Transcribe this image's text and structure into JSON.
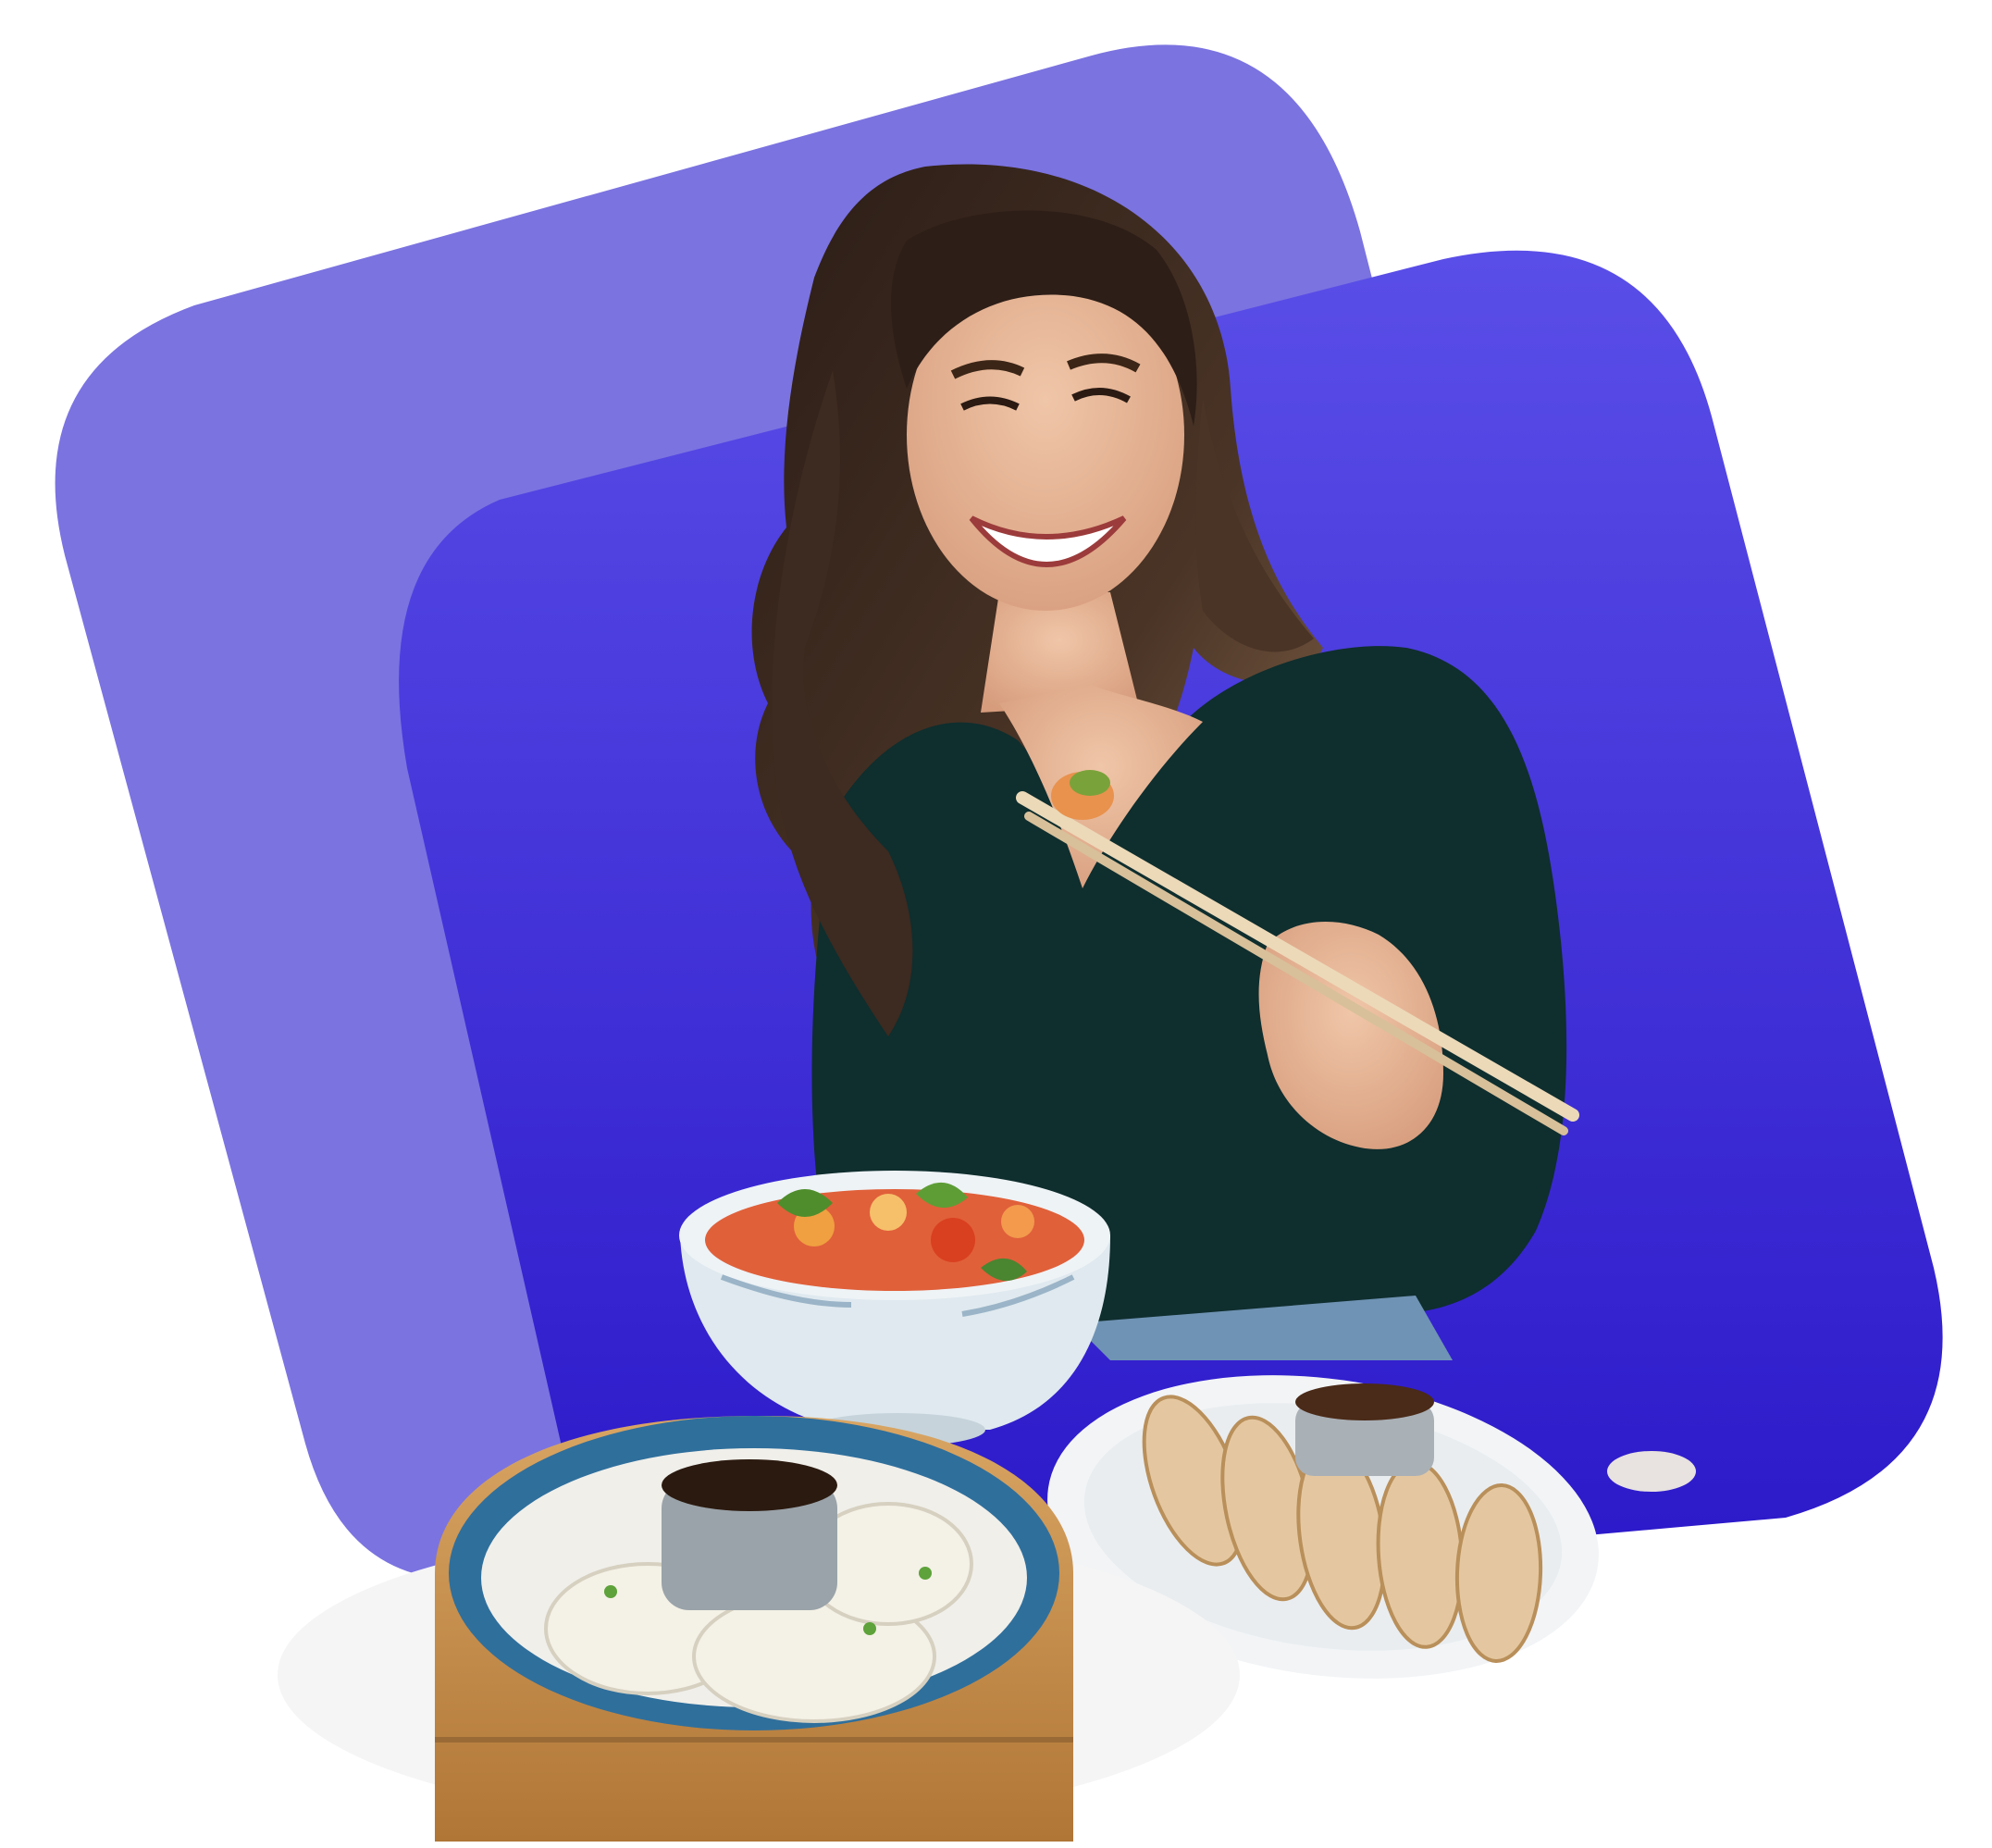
{
  "colors": {
    "background": "#ffffff",
    "back_shape": "#7b73e0",
    "front_shape_top": "#5a4ee8",
    "front_shape_bottom": "#2a17c8",
    "top_color": "#0f2e2e",
    "hair_color": "#3b2a22",
    "skin_color": "#e8b89a",
    "bowl_color": "#dfe9ef",
    "steamer_color": "#c98f4e",
    "plate_color": "#f2f4f6",
    "chopstick_color": "#ecd9b8"
  },
  "scene": {
    "description_icons": [
      "person-icon",
      "chopsticks-icon",
      "bowl-icon",
      "dumpling-steamer-icon",
      "gyoza-plate-icon"
    ]
  }
}
